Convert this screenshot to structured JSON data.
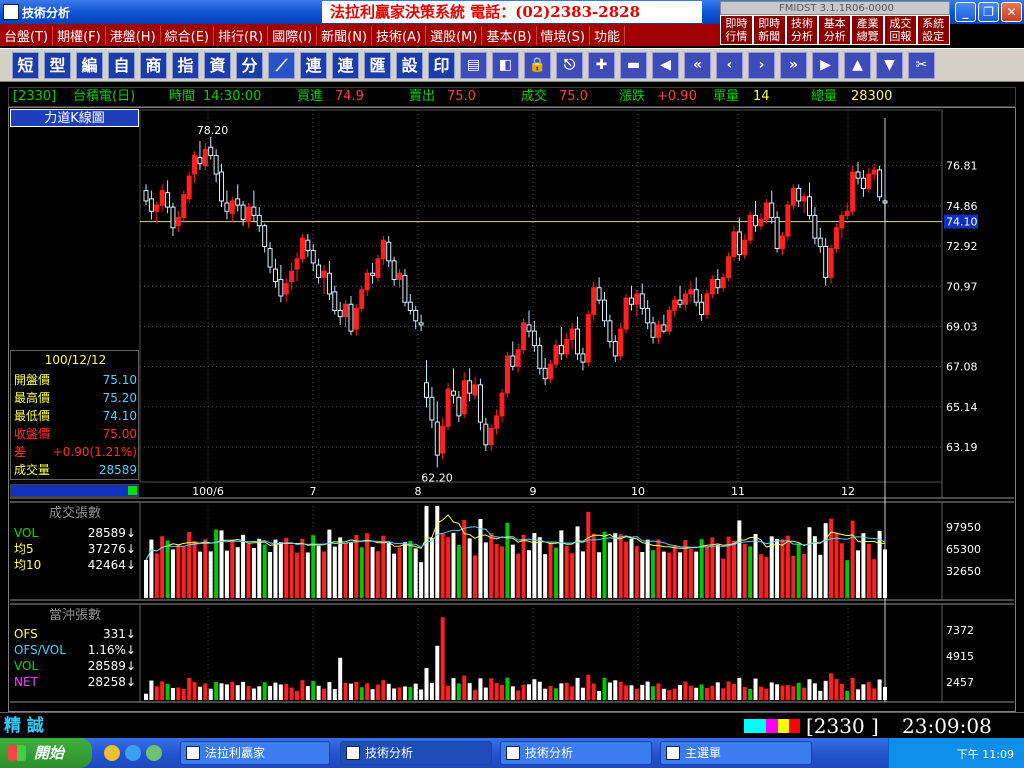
{
  "window": {
    "title": "技術分析",
    "banner": "法拉利贏家決策系統 電話：(02)2383-2828"
  },
  "fmidst": {
    "version": "FMIDST 3.1.1R06-0000"
  },
  "quick_buttons": [
    {
      "line1": "即時",
      "line2": "行情"
    },
    {
      "line1": "即時",
      "line2": "新聞"
    },
    {
      "line1": "技術",
      "line2": "分析"
    },
    {
      "line1": "基本",
      "line2": "分析"
    },
    {
      "line1": "產業",
      "line2": "總覽"
    },
    {
      "line1": "成交",
      "line2": "回報"
    },
    {
      "line1": "系統",
      "line2": "設定"
    }
  ],
  "menu": [
    "台盤(T)",
    "期權(F)",
    "港盤(H)",
    "綜合(E)",
    "排行(R)",
    "國際(I)",
    "新聞(N)",
    "技術(A)",
    "選股(M)",
    "基本(B)",
    "情境(S)",
    "功能"
  ],
  "toolbar_text": [
    "短",
    "型",
    "編",
    "自",
    "商",
    "指",
    "資",
    "分"
  ],
  "toolbar_text2": [
    "連",
    "連",
    "匯",
    "設",
    "印"
  ],
  "info": {
    "code": "[2330]",
    "name": "台積電(日)",
    "time_label": "時間",
    "time": "14:30:00",
    "bid_label": "買進",
    "bid": "74.9",
    "ask_label": "賣出",
    "ask": "75.0",
    "last_label": "成交",
    "last": "75.0",
    "change_label": "漲跌",
    "change": "+0.90",
    "unit_label": "單量",
    "unit": "14",
    "total_label": "總量",
    "total": "28300"
  },
  "left_panel": {
    "kline_label": "力道K線圖",
    "date": "100/12/12",
    "rows": [
      {
        "k": "開盤價",
        "v": "75.10",
        "kc": "#ffff55",
        "vc": "#55d0ff"
      },
      {
        "k": "最高價",
        "v": "75.20",
        "kc": "#ffff55",
        "vc": "#55d0ff"
      },
      {
        "k": "最低價",
        "v": "74.10",
        "kc": "#ffff55",
        "vc": "#55d0ff"
      },
      {
        "k": "收盤價",
        "v": "75.00",
        "kc": "#ff3030",
        "vc": "#ff3030"
      },
      {
        "k": "差",
        "v": "+0.90(1.21%)",
        "kc": "#ff3030",
        "vc": "#ff3030"
      },
      {
        "k": "成交量",
        "v": "28589",
        "kc": "#ffff55",
        "vc": "#55d0ff"
      }
    ]
  },
  "vol_panel": {
    "title": "成交張數",
    "rows": [
      {
        "k": "VOL",
        "v": "28589↓",
        "kc": "#00e000"
      },
      {
        "k": "均5",
        "v": "37276↓",
        "kc": "#ffff55"
      },
      {
        "k": "均10",
        "v": "42464↓",
        "kc": "#ffff55"
      }
    ],
    "ticks": [
      "97950",
      "65300",
      "32650"
    ]
  },
  "ofs_panel": {
    "title": "當沖張數",
    "rows": [
      {
        "k": "OFS",
        "v": "331↓",
        "kc": "#ffff55"
      },
      {
        "k": "OFS/VOL",
        "v": "1.16%↓",
        "kc": "#55d0ff"
      },
      {
        "k": "VOL",
        "v": "28589↓",
        "kc": "#00e000"
      },
      {
        "k": "NET",
        "v": "28258↓",
        "kc": "#ff40ff"
      }
    ],
    "ticks": [
      "7372",
      "4915",
      "2457"
    ]
  },
  "chart_data": {
    "type": "candlestick",
    "price_ticks": [
      "76.81",
      "74.86",
      "72.92",
      "70.97",
      "69.03",
      "67.08",
      "65.14",
      "63.19"
    ],
    "current_price": "74.10",
    "high_label": "78.20",
    "low_label": "62.20",
    "x_labels": [
      "100/6",
      "7",
      "8",
      "9",
      "10",
      "11",
      "12"
    ],
    "ylim": [
      61.5,
      79.5
    ],
    "candles": [
      [
        75.6,
        75.9,
        74.9,
        75.1
      ],
      [
        75.2,
        75.6,
        74.2,
        74.6
      ],
      [
        74.6,
        75.1,
        74.0,
        74.9
      ],
      [
        74.9,
        75.9,
        74.6,
        75.6
      ],
      [
        75.5,
        76.1,
        74.5,
        74.8
      ],
      [
        74.8,
        75.0,
        73.4,
        73.8
      ],
      [
        73.9,
        74.6,
        73.6,
        74.3
      ],
      [
        74.3,
        75.6,
        74.1,
        75.4
      ],
      [
        75.2,
        76.5,
        75.0,
        76.3
      ],
      [
        76.4,
        77.5,
        76.0,
        77.3
      ],
      [
        77.2,
        78.0,
        76.6,
        76.9
      ],
      [
        76.8,
        77.9,
        76.6,
        77.6
      ],
      [
        77.7,
        78.2,
        77.1,
        77.3
      ],
      [
        77.3,
        77.6,
        76.0,
        76.4
      ],
      [
        76.5,
        76.9,
        74.8,
        75.1
      ],
      [
        75.0,
        75.6,
        74.2,
        74.6
      ],
      [
        74.5,
        75.3,
        74.1,
        75.1
      ],
      [
        75.2,
        75.9,
        74.6,
        74.9
      ],
      [
        74.9,
        75.1,
        73.9,
        74.2
      ],
      [
        74.1,
        75.0,
        73.8,
        74.8
      ],
      [
        74.8,
        75.6,
        74.1,
        74.4
      ],
      [
        74.4,
        74.8,
        73.6,
        73.9
      ],
      [
        73.9,
        74.0,
        72.6,
        72.9
      ],
      [
        72.8,
        73.1,
        71.6,
        71.9
      ],
      [
        71.8,
        72.3,
        70.9,
        71.2
      ],
      [
        71.3,
        72.0,
        70.2,
        70.5
      ],
      [
        70.6,
        71.4,
        70.2,
        71.1
      ],
      [
        71.2,
        72.1,
        70.8,
        71.7
      ],
      [
        71.8,
        72.6,
        71.2,
        72.3
      ],
      [
        72.3,
        73.5,
        72.1,
        73.3
      ],
      [
        73.2,
        73.5,
        72.4,
        72.7
      ],
      [
        72.7,
        73.0,
        71.7,
        72.1
      ],
      [
        72.0,
        72.3,
        71.1,
        71.4
      ],
      [
        71.4,
        72.0,
        70.6,
        71.7
      ],
      [
        71.6,
        72.2,
        70.3,
        70.6
      ],
      [
        70.7,
        71.0,
        69.6,
        69.8
      ],
      [
        69.8,
        70.2,
        69.1,
        69.5
      ],
      [
        69.5,
        70.3,
        69.0,
        70.1
      ],
      [
        70.1,
        70.5,
        68.6,
        68.8
      ],
      [
        68.9,
        70.1,
        68.6,
        69.9
      ],
      [
        69.9,
        71.0,
        69.7,
        70.8
      ],
      [
        70.8,
        71.8,
        70.5,
        71.6
      ],
      [
        71.6,
        72.1,
        71.1,
        71.5
      ],
      [
        71.4,
        72.5,
        71.2,
        72.3
      ],
      [
        72.3,
        73.4,
        72.0,
        73.2
      ],
      [
        73.1,
        73.4,
        71.9,
        72.2
      ],
      [
        72.2,
        72.4,
        71.0,
        71.3
      ],
      [
        71.3,
        71.8,
        70.9,
        71.6
      ],
      [
        71.5,
        71.8,
        70.0,
        70.2
      ],
      [
        70.2,
        70.6,
        69.6,
        69.8
      ],
      [
        69.8,
        70.0,
        68.9,
        69.3
      ],
      [
        69.2,
        69.6,
        68.8,
        69.1
      ],
      [
        66.3,
        67.4,
        65.1,
        65.6
      ],
      [
        65.6,
        66.1,
        64.1,
        64.5
      ],
      [
        64.4,
        65.4,
        62.2,
        62.8
      ],
      [
        62.9,
        64.6,
        62.6,
        64.2
      ],
      [
        64.2,
        66.3,
        64.0,
        66.0
      ],
      [
        65.9,
        67.0,
        65.3,
        65.7
      ],
      [
        65.6,
        65.9,
        64.4,
        64.7
      ],
      [
        64.8,
        66.8,
        64.6,
        66.4
      ],
      [
        66.4,
        67.0,
        65.4,
        65.8
      ],
      [
        65.7,
        66.6,
        65.5,
        66.2
      ],
      [
        66.2,
        66.5,
        64.0,
        64.4
      ],
      [
        64.3,
        64.6,
        63.0,
        63.3
      ],
      [
        63.3,
        64.3,
        63.0,
        64.1
      ],
      [
        64.1,
        65.0,
        63.8,
        64.7
      ],
      [
        64.7,
        66.0,
        64.4,
        65.8
      ],
      [
        65.8,
        67.8,
        65.6,
        67.6
      ],
      [
        67.6,
        68.3,
        66.9,
        67.1
      ],
      [
        67.1,
        68.2,
        66.8,
        67.9
      ],
      [
        67.9,
        69.4,
        67.7,
        69.2
      ],
      [
        69.1,
        69.8,
        68.5,
        68.8
      ],
      [
        68.8,
        69.3,
        67.8,
        68.1
      ],
      [
        68.1,
        68.5,
        66.7,
        67.0
      ],
      [
        67.0,
        67.5,
        66.2,
        66.5
      ],
      [
        66.5,
        67.4,
        66.3,
        67.2
      ],
      [
        67.2,
        68.4,
        67.0,
        68.1
      ],
      [
        68.1,
        69.0,
        67.4,
        67.7
      ],
      [
        67.7,
        68.7,
        67.5,
        68.4
      ],
      [
        68.4,
        69.2,
        67.9,
        68.9
      ],
      [
        68.9,
        69.5,
        67.4,
        67.7
      ],
      [
        67.7,
        68.0,
        66.9,
        67.3
      ],
      [
        67.3,
        69.8,
        67.1,
        69.6
      ],
      [
        69.6,
        71.2,
        69.3,
        70.9
      ],
      [
        70.9,
        71.4,
        70.1,
        70.3
      ],
      [
        70.3,
        70.7,
        69.0,
        69.3
      ],
      [
        69.3,
        69.6,
        68.0,
        68.3
      ],
      [
        68.3,
        68.6,
        67.3,
        67.6
      ],
      [
        67.6,
        69.2,
        67.4,
        68.9
      ],
      [
        68.9,
        70.6,
        68.7,
        70.4
      ],
      [
        70.4,
        71.0,
        69.8,
        70.1
      ],
      [
        70.1,
        70.8,
        69.5,
        70.6
      ],
      [
        70.6,
        71.1,
        69.6,
        69.9
      ],
      [
        69.9,
        70.3,
        68.9,
        69.2
      ],
      [
        69.2,
        69.5,
        68.2,
        68.5
      ],
      [
        68.5,
        69.3,
        68.2,
        69.1
      ],
      [
        69.1,
        69.6,
        68.7,
        68.8
      ],
      [
        68.8,
        70.0,
        68.6,
        69.8
      ],
      [
        69.8,
        70.5,
        69.5,
        70.3
      ],
      [
        70.3,
        71.0,
        69.9,
        70.1
      ],
      [
        70.1,
        70.8,
        69.8,
        70.6
      ],
      [
        70.6,
        71.2,
        70.2,
        70.8
      ],
      [
        70.8,
        71.4,
        70.0,
        70.2
      ],
      [
        70.2,
        70.6,
        69.3,
        69.6
      ],
      [
        69.6,
        70.8,
        69.4,
        70.6
      ],
      [
        70.6,
        71.5,
        70.4,
        71.3
      ],
      [
        71.3,
        71.8,
        70.6,
        70.9
      ],
      [
        70.9,
        71.6,
        70.7,
        71.4
      ],
      [
        71.4,
        72.6,
        71.2,
        72.4
      ],
      [
        72.4,
        73.9,
        72.2,
        73.6
      ],
      [
        73.6,
        74.3,
        72.2,
        72.5
      ],
      [
        72.5,
        73.5,
        72.3,
        73.2
      ],
      [
        73.2,
        74.6,
        73.0,
        74.4
      ],
      [
        74.4,
        75.1,
        73.6,
        73.9
      ],
      [
        73.9,
        74.5,
        73.7,
        74.2
      ],
      [
        74.2,
        75.2,
        74.0,
        75.0
      ],
      [
        75.0,
        75.6,
        74.0,
        74.3
      ],
      [
        74.3,
        74.6,
        72.6,
        72.8
      ],
      [
        72.8,
        73.6,
        72.5,
        73.4
      ],
      [
        73.4,
        75.1,
        73.2,
        74.9
      ],
      [
        74.9,
        75.9,
        74.7,
        75.7
      ],
      [
        75.7,
        75.9,
        74.8,
        75.1
      ],
      [
        75.1,
        75.5,
        74.5,
        75.3
      ],
      [
        75.3,
        76.0,
        74.2,
        74.4
      ],
      [
        74.4,
        74.8,
        73.0,
        73.3
      ],
      [
        73.3,
        73.8,
        72.6,
        72.9
      ],
      [
        72.9,
        73.3,
        71.0,
        71.4
      ],
      [
        71.4,
        73.0,
        71.1,
        72.8
      ],
      [
        72.8,
        74.0,
        72.6,
        73.8
      ],
      [
        73.8,
        74.6,
        73.3,
        74.4
      ],
      [
        74.4,
        75.0,
        74.2,
        74.6
      ],
      [
        74.6,
        76.8,
        74.4,
        76.5
      ],
      [
        76.5,
        77.0,
        75.9,
        76.2
      ],
      [
        76.2,
        76.6,
        75.3,
        75.7
      ],
      [
        75.7,
        76.7,
        75.5,
        76.4
      ],
      [
        76.4,
        76.9,
        76.1,
        76.6
      ],
      [
        76.6,
        76.8,
        75.1,
        75.3
      ],
      [
        75.1,
        75.2,
        74.1,
        75.0
      ]
    ]
  }
}
